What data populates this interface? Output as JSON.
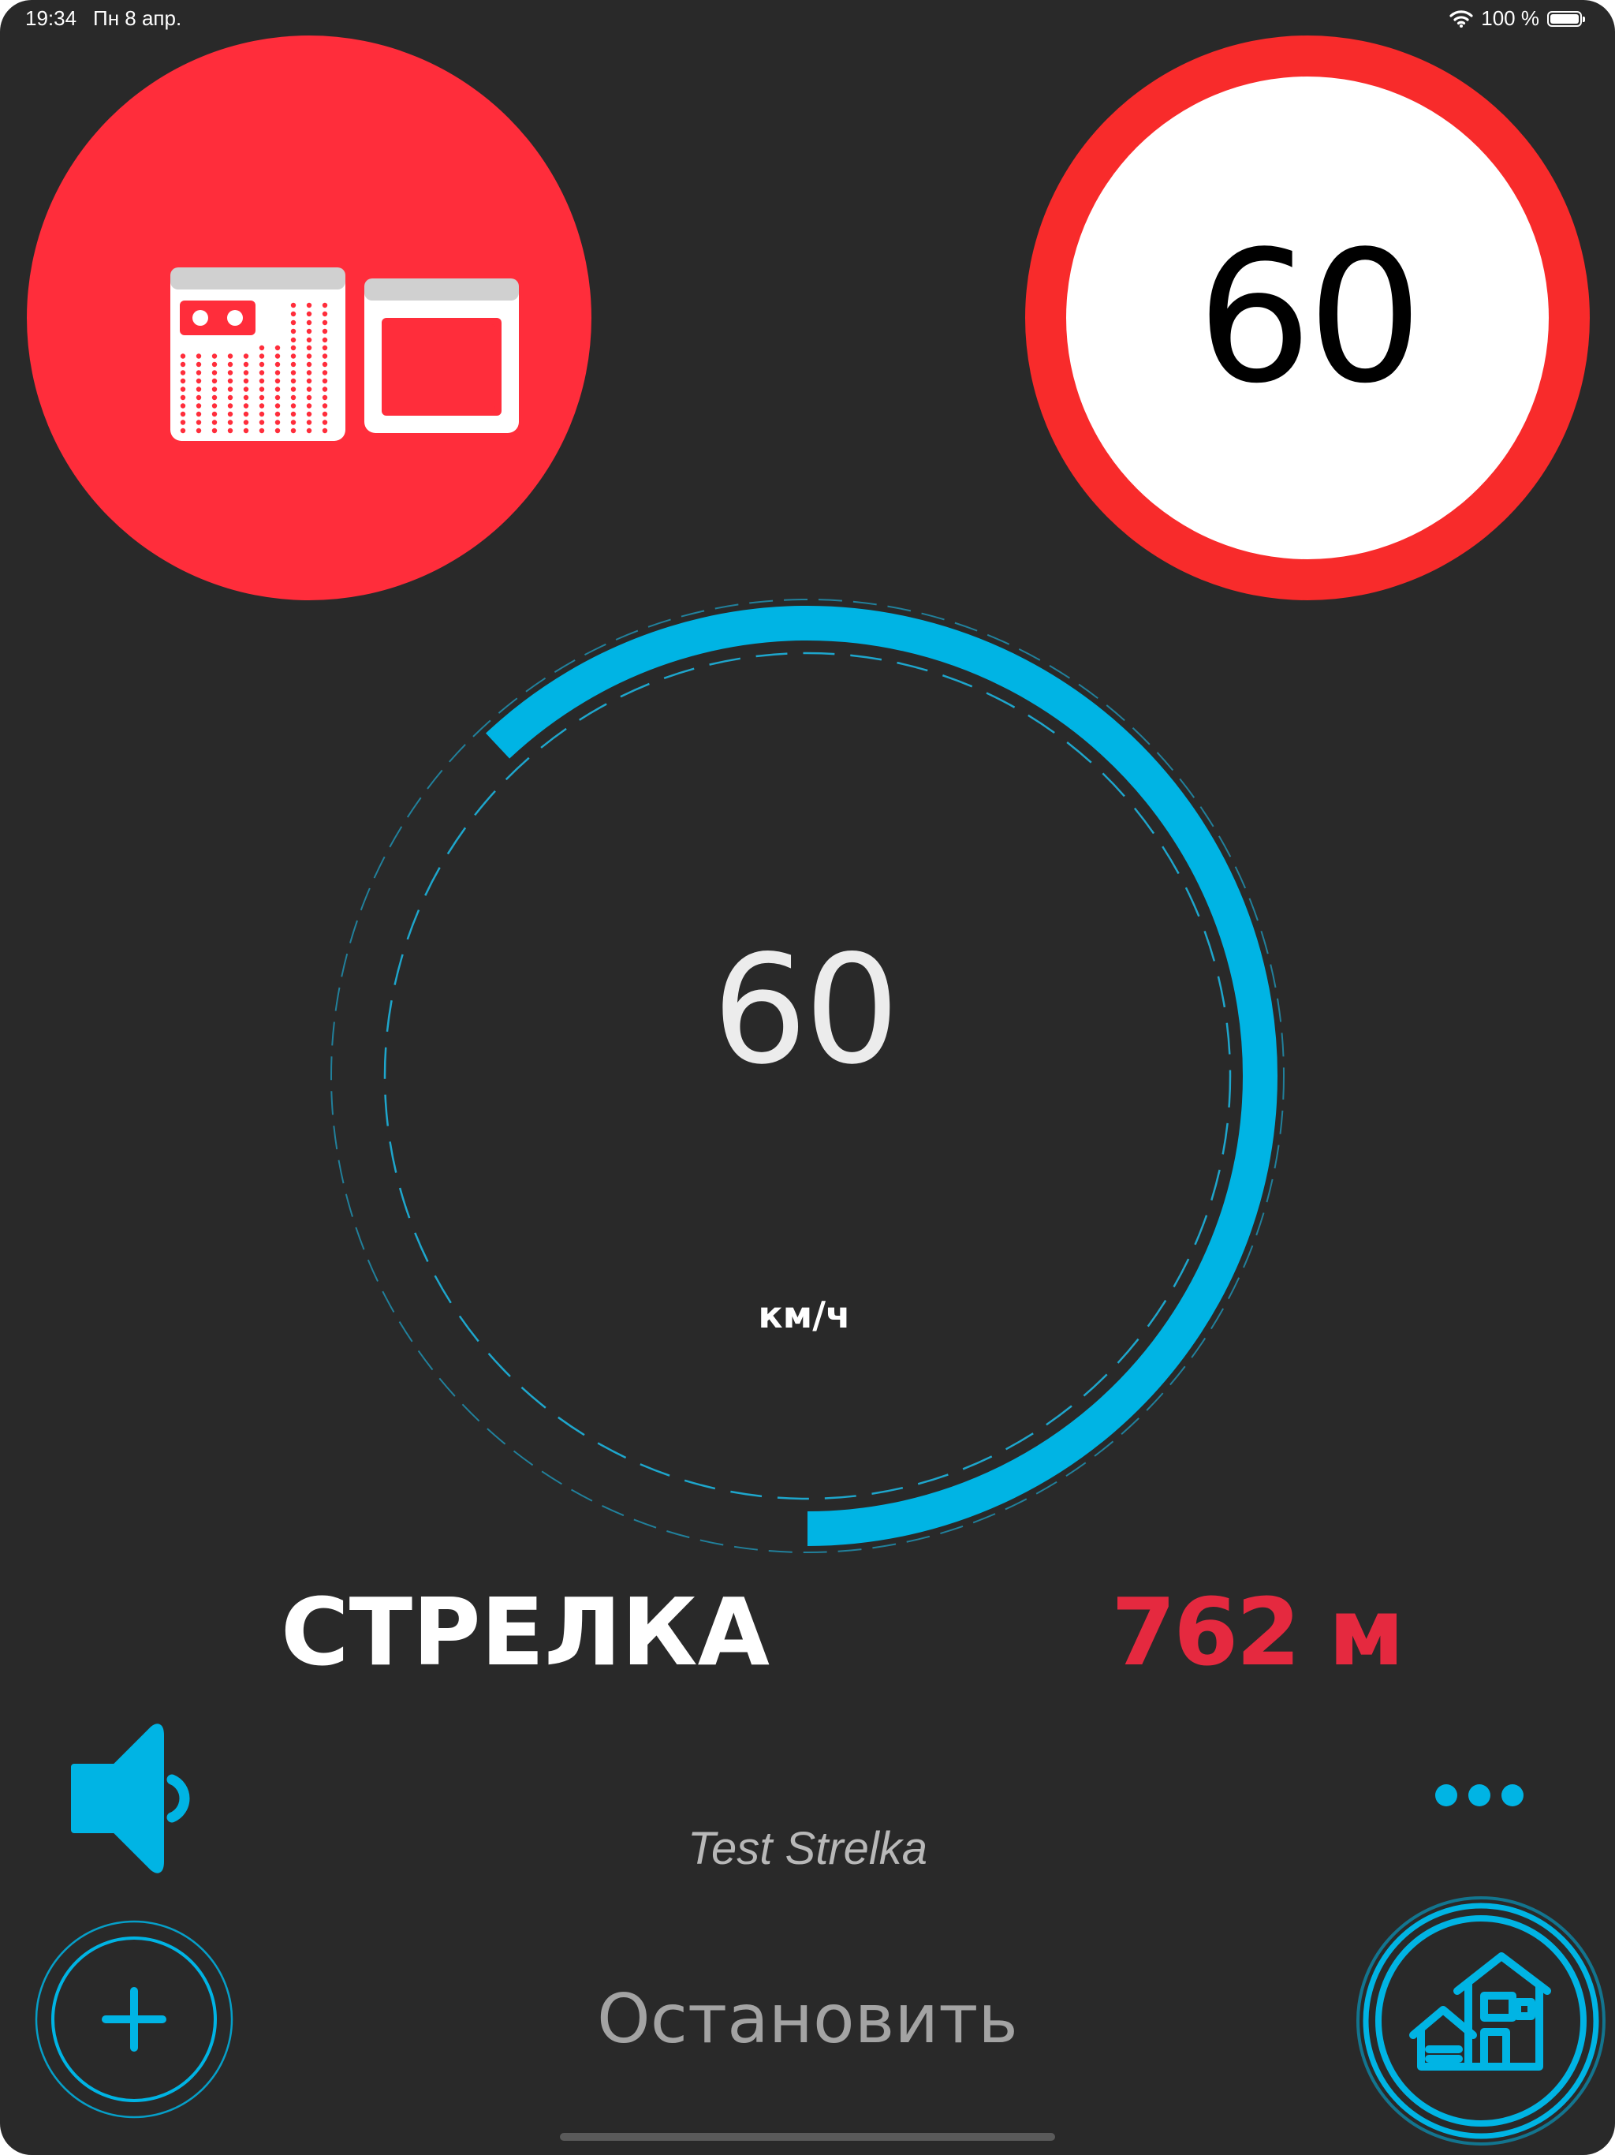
{
  "status_bar": {
    "time": "19:34",
    "date": "Пн 8 апр.",
    "battery": "100 %",
    "wifi_icon": "wifi-icon",
    "battery_icon": "battery-icon"
  },
  "camera": {
    "icon": "speed-radar-camera-icon",
    "background_color": "#ff2d3b"
  },
  "speed_limit": {
    "value": "60",
    "ring_color": "#f82b2b"
  },
  "speedometer": {
    "speed": "60",
    "unit": "км/ч",
    "arc_color": "#00b4e4",
    "arc_fraction": 0.62
  },
  "alert": {
    "camera_type": "СТРЕЛКА",
    "distance": "762 м",
    "distance_color": "#e5293f"
  },
  "controls": {
    "sound_icon": "speaker-icon",
    "more_icon": "more-dots-icon",
    "route_name": "Test Strelka",
    "add_icon": "plus-icon",
    "stop_label": "Остановить",
    "home_icon": "house-icon",
    "accent_color": "#00b4e4"
  }
}
